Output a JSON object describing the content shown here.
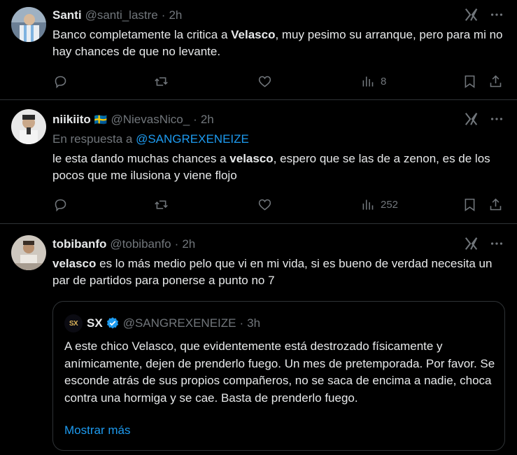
{
  "tweets": [
    {
      "name": "Santi",
      "handle": "@santi_lastre",
      "time": "2h",
      "text_before": "Banco completamente la critica a ",
      "text_bold": "Velasco",
      "text_after": ", muy pesimo su arranque, pero para mi no hay chances de que no levante.",
      "views": "8"
    },
    {
      "name": "niikiito",
      "flag": "🇸🇪",
      "handle": "@NievasNico_",
      "time": "2h",
      "reply_prefix": "En respuesta a ",
      "reply_mention": "@SANGREXENEIZE",
      "text_before": "le esta dando muchas chances a ",
      "text_bold": "velasco",
      "text_after": ", espero que se las de a zenon, es de los pocos que me ilusiona y viene flojo",
      "views": "252"
    },
    {
      "name": "tobibanfo",
      "handle": "@tobibanfo",
      "time": "2h",
      "text_before": "",
      "text_bold": "velasco",
      "text_after": " es lo más medio pelo que vi en mi vida, si es bueno de verdad necesita un par de partidos para ponerse a punto no 7"
    }
  ],
  "quote": {
    "name": "SX",
    "handle": "@SANGREXENEIZE",
    "time": "3h",
    "text": "A este chico Velasco, que evidentemente está destrozado físicamente y anímicamente, dejen de prenderlo fuego. Un mes de pretemporada. Por favor. Se esconde atrás de sus propios compañeros, no se saca de encima a nadie, choca contra una hormiga y se cae. Basta de prenderlo fuego.",
    "show_more": "Mostrar más",
    "avatar_letters": "SX"
  },
  "dot": "·",
  "icons": {
    "reply": "reply-icon",
    "retweet": "retweet-icon",
    "like": "heart-icon",
    "views": "views-icon",
    "bookmark": "bookmark-icon",
    "share": "share-icon",
    "grok": "grok-icon",
    "more": "more-icon",
    "verified": "verified-badge-icon"
  },
  "colors": {
    "background": "#000000",
    "text": "#e7e9ea",
    "muted": "#71767b",
    "accent": "#1d9bf0",
    "border": "#2f3336"
  }
}
